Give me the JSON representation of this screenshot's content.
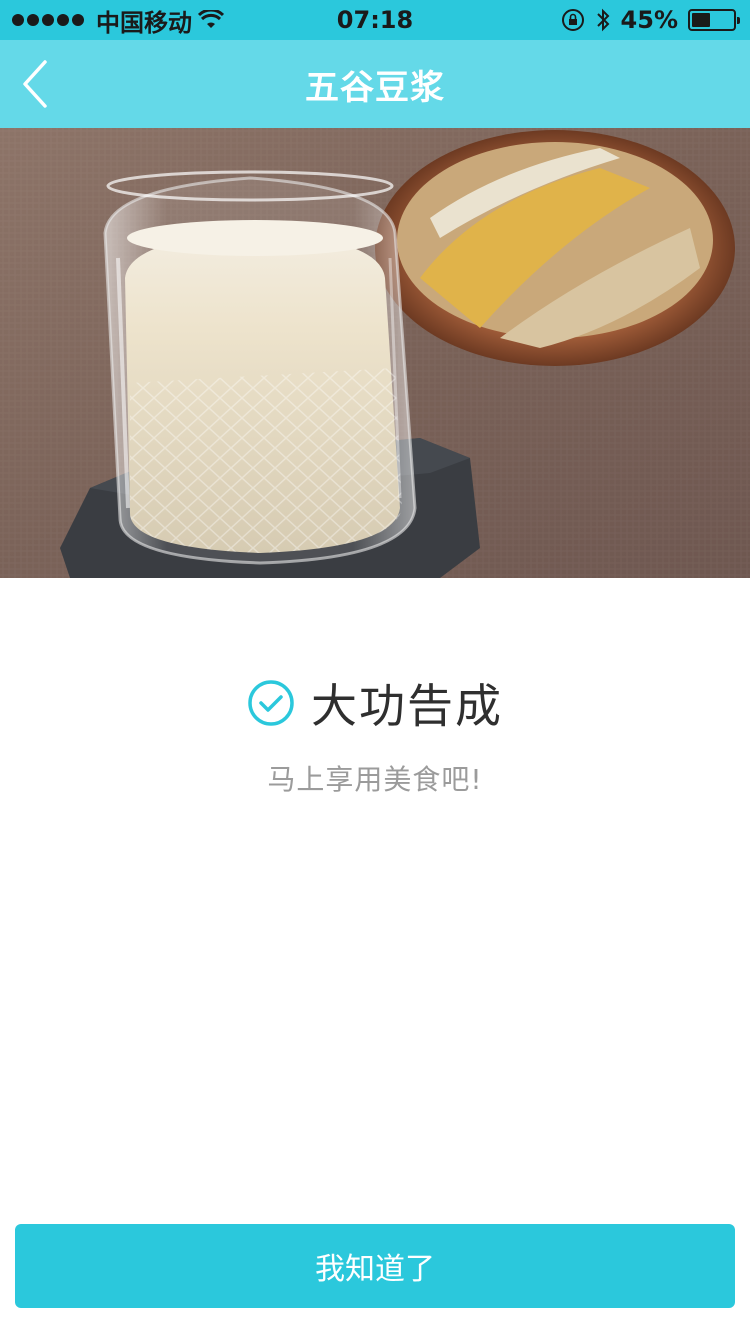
{
  "status_bar": {
    "carrier": "中国移动",
    "time": "07:18",
    "battery_percent": "45%",
    "battery_level": 0.45,
    "icons": [
      "signal-dots-icon",
      "wifi-icon",
      "rotation-lock-icon",
      "bluetooth-icon",
      "battery-icon"
    ]
  },
  "nav": {
    "title": "五谷豆浆",
    "back_icon": "chevron-left-icon"
  },
  "hero": {
    "image": "soy-milk-glass-photo"
  },
  "result": {
    "icon": "check-circle-icon",
    "title": "大功告成",
    "subtitle": "马上享用美食吧!"
  },
  "actions": {
    "confirm_label": "我知道了"
  },
  "colors": {
    "status_bar": "#2bc8dc",
    "nav_bar": "#64d9e8",
    "accent": "#2bc8dc",
    "title_text": "#2f2f2f",
    "subtitle_text": "#9b9b9b"
  }
}
